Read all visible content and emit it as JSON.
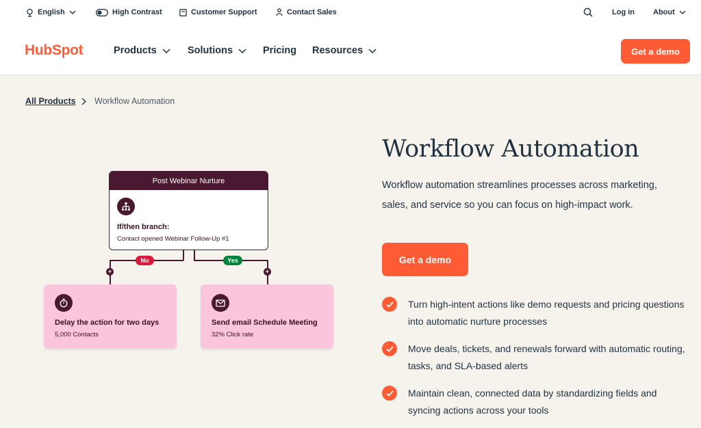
{
  "utility_bar": {
    "language": "English",
    "high_contrast": "High Contrast",
    "customer_support": "Customer Support",
    "contact_sales": "Contact Sales",
    "login": "Log in",
    "about": "About"
  },
  "nav": {
    "logo": "HubSpot",
    "items": [
      "Products",
      "Solutions",
      "Pricing",
      "Resources"
    ],
    "cta": "Get a demo"
  },
  "breadcrumb": {
    "parent": "All Products",
    "current": "Workflow Automation"
  },
  "hero": {
    "title": "Workflow Automation",
    "description": "Workflow automation streamlines processes across marketing, sales, and service so you can focus on high-impact work.",
    "cta": "Get a demo",
    "bullets": [
      "Turn high-intent actions like demo requests and pricing questions into automatic nurture processes",
      "Move deals, tickets, and renewals forward with automatic routing, tasks, and SLA-based alerts",
      "Maintain clean, connected data by standardizing fields and syncing actions across your tools"
    ]
  },
  "diagram": {
    "header": "Post Webinar Nurture",
    "branch_title": "If/then branch:",
    "branch_subtitle": "Contact opened Webinar Follow-Up #1",
    "no_label": "No",
    "yes_label": "Yes",
    "left_card": {
      "title": "Delay the action for two days",
      "subtitle": "5,000 Contacts"
    },
    "right_card": {
      "title": "Send email Schedule Meeting",
      "subtitle": "32% Click rate"
    }
  },
  "colors": {
    "brand_orange": "#ff5c35",
    "plum": "#4a1830",
    "pink_card": "#fbc5dd",
    "no_red": "#d9183b",
    "yes_green": "#00823a",
    "background": "#f6f3ed"
  }
}
